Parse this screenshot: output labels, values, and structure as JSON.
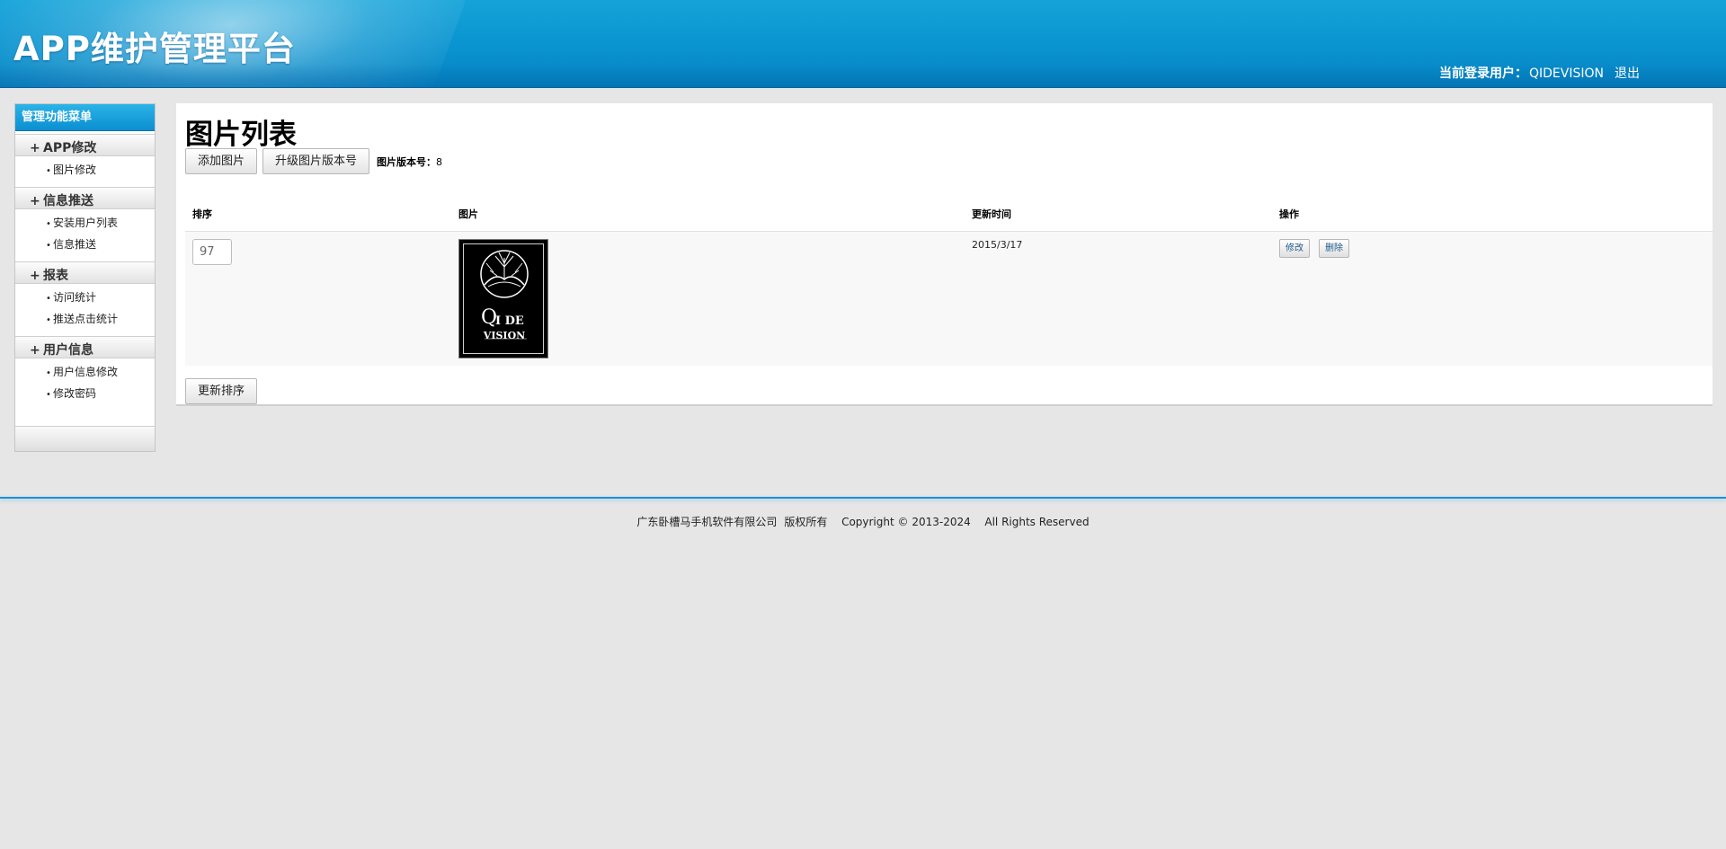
{
  "header": {
    "title": "APP维护管理平台",
    "user_label": "当前登录用户：",
    "username": "QIDEVISION",
    "logout_label": "退出"
  },
  "sidebar": {
    "title": "管理功能菜单",
    "groups": [
      {
        "label": "APP修改",
        "items": [
          "图片修改"
        ]
      },
      {
        "label": "信息推送",
        "items": [
          "安装用户列表",
          "信息推送"
        ]
      },
      {
        "label": "报表",
        "items": [
          "访问统计",
          "推送点击统计"
        ]
      },
      {
        "label": "用户信息",
        "items": [
          "用户信息修改",
          "修改密码"
        ]
      }
    ],
    "expand_symbol": "+",
    "bullet_symbol": "•"
  },
  "main": {
    "title": "图片列表",
    "add_button": "添加图片",
    "upgrade_button": "升级图片版本号",
    "version_label": "图片版本号：",
    "version_value": "8",
    "table": {
      "headers": [
        "排序",
        "图片",
        "更新时间",
        "操作"
      ],
      "rows": [
        {
          "order": "97",
          "image_text_line1": "I DE",
          "image_text_line2": "VISION",
          "image_initial": "Q",
          "updated": "2015/3/17",
          "edit_label": "修改",
          "delete_label": "删除"
        }
      ]
    },
    "update_sort_button": "更新排序"
  },
  "footer": {
    "company": "广东卧槽马手机软件有限公司",
    "rights_cn": "版权所有",
    "copyright": "Copyright © 2013-2024",
    "rights_en": "All Rights Reserved"
  },
  "colors": {
    "header_blue": "#0a93cf",
    "accent_line": "#1b8fd6"
  }
}
